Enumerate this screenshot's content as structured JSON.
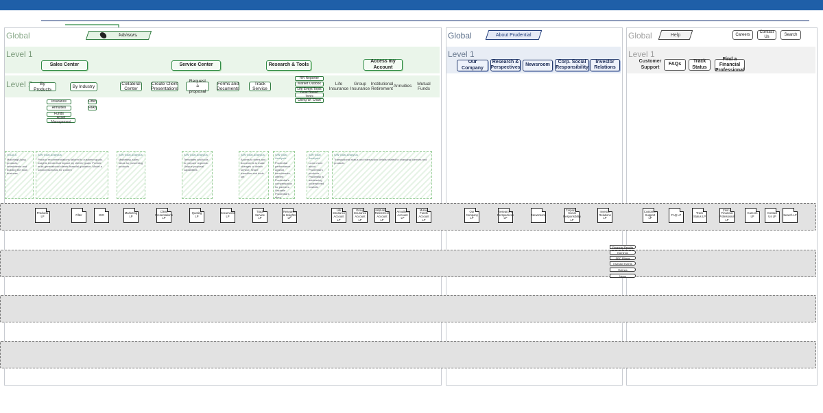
{
  "colors": {
    "topbar": "#1f5fa8",
    "green": "#2f7a3f",
    "blue": "#23396b",
    "gray": "#555555"
  },
  "sections": {
    "advisors": {
      "global": "Global",
      "level1": "Level 1",
      "level2": "Level 2",
      "root": "Advisors",
      "root_icon": "logo-icon",
      "l1": [
        "Sales Center",
        "Service Center",
        "Research & Tools",
        "Access my Account"
      ],
      "l2_sales": [
        "By Products",
        "By Industry"
      ],
      "products_list": [
        "Insurance",
        "Annuities",
        "Funds",
        "Asset Management"
      ],
      "industry_list": [
        "Offer",
        "RIAs"
      ],
      "l2_service": [
        "Collateral Center",
        "Create Client Presentations",
        "Request a proposal",
        "Forms and Documents",
        "Track Service"
      ],
      "research_list": [
        "RR Reporter",
        "Market Outlook",
        "Life Event Tools",
        "Goal Based Tools",
        "Using W. Chart"
      ],
      "l2_account": [
        "Life Insurance",
        "Group Insurance",
        "Institutional Retirement",
        "Annuities",
        "Mutual Funds"
      ],
      "notes": [
        {
          "title": "GOALS",
          "body": "Matching/Using products, investments and building the book business"
        },
        {
          "title": "S/W Goal Analysis",
          "body": "Product recommendations tailored to customer goals. Insights trends that impact my clients' goals. Provide multi-generational clients financial guidance. Model a solution/scenario for a client"
        },
        {
          "title": "S/W Goal Analysis",
          "body": "Marketing, sales ideas for presenting products"
        },
        {
          "title": "S/W Goal Analysis",
          "body": "Templates and tools to prepare requests. Unique proposal capabilities"
        },
        {
          "title": "S/W Goal Analysis",
          "body": "Access to forms and documents to make changes or obtain service. Share transition and tools set"
        },
        {
          "title": "S/W Goal Analysis",
          "body": "Prudential performance against benchmarks, offered Prudential's compensation for partners. Valuable Prudential's story"
        },
        {
          "title": "S/W Goal Analysis",
          "body": "Learn more about Prudential's products. Prudential is addressing underserved markets"
        },
        {
          "title": "S/W Goal Analysis",
          "body": "Transactional status and transaction details related to changing licenses and products"
        }
      ],
      "docs": [
        "Products LP",
        "Filter",
        "IDO",
        "Marketing LP",
        "Client Presentations LP",
        "Quoting LP",
        "Documents LP",
        "Track Service LP",
        "Research & Insights LP",
        "Life Insurance Account LP",
        "Group Insurance Account LP",
        "Institutional Retirement Account LP",
        "Annuities Account LP",
        "Mutual Funds Account LP"
      ]
    },
    "about": {
      "global": "Global",
      "level1": "Level 1",
      "root": "About Prudential",
      "l1": [
        "Our Company",
        "Research & Perspectives",
        "Newsroom",
        "Corp. Social Responsibility",
        "Investor Relations"
      ],
      "docs": [
        "Our Company LP",
        "Research & Perspectives LP",
        "Newsroom",
        "Corporate Social Responsibility LP",
        "Investor Relations LP"
      ],
      "investor_list": [
        "Financial Results",
        "Earnings",
        "SEC Filings",
        "Investor Events",
        "Ratings",
        "News"
      ]
    },
    "help": {
      "global": "Global",
      "level1": "Level 1",
      "root": "Help",
      "top_links": [
        "Careers",
        "Contact Us",
        "Search"
      ],
      "l1": [
        "Customer Support",
        "FAQs",
        "Track Status",
        "Find a Financial Professional"
      ],
      "docs": [
        "Customer Support LP",
        "FAQ LP",
        "Track Status LP",
        "Find a Financial Professional LP",
        "Careers LP",
        "Contact Us LP",
        "Search LP"
      ]
    }
  }
}
